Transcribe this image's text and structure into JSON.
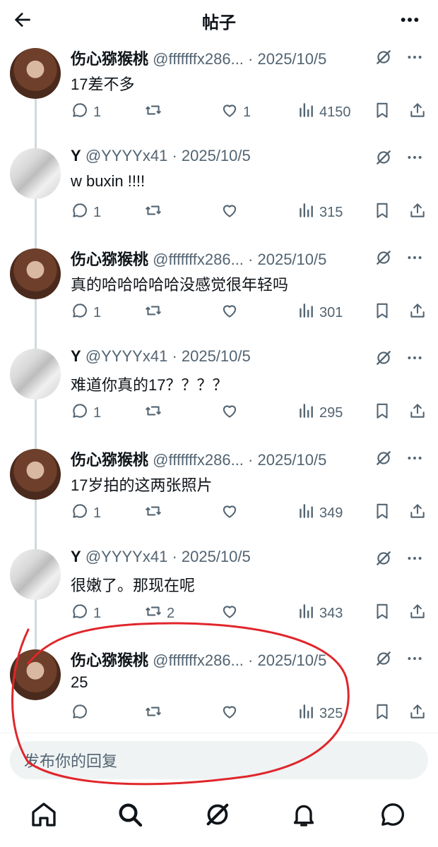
{
  "header": {
    "title": "帖子"
  },
  "tweets": [
    {
      "name": "伤心猕猴桃",
      "handle": "@fffffffx286...",
      "date": "· 2025/10/5",
      "text": "17差不多",
      "replies": "1",
      "retweets": "",
      "likes": "1",
      "views": "4150",
      "avatar": "female"
    },
    {
      "name": "Y",
      "handle": "@YYYYx41",
      "date": "· 2025/10/5",
      "text": "w buxin !!!!",
      "replies": "1",
      "retweets": "",
      "likes": "",
      "views": "315",
      "avatar": "y"
    },
    {
      "name": "伤心猕猴桃",
      "handle": "@fffffffx286...",
      "date": "· 2025/10/5",
      "text": "真的哈哈哈哈哈没感觉很年轻吗",
      "replies": "1",
      "retweets": "",
      "likes": "",
      "views": "301",
      "avatar": "female"
    },
    {
      "name": "Y",
      "handle": "@YYYYx41",
      "date": "· 2025/10/5",
      "text": "难道你真的17？？？？",
      "replies": "1",
      "retweets": "",
      "likes": "",
      "views": "295",
      "avatar": "y"
    },
    {
      "name": "伤心猕猴桃",
      "handle": "@fffffffx286...",
      "date": "· 2025/10/5",
      "text": "17岁拍的这两张照片",
      "replies": "1",
      "retweets": "",
      "likes": "",
      "views": "349",
      "avatar": "female"
    },
    {
      "name": "Y",
      "handle": "@YYYYx41",
      "date": "· 2025/10/5",
      "text": "很嫩了。那现在呢",
      "replies": "1",
      "retweets": "2",
      "likes": "",
      "views": "343",
      "avatar": "y"
    },
    {
      "name": "伤心猕猴桃",
      "handle": "@fffffffx286...",
      "date": "· 2025/10/5",
      "text": "25",
      "replies": "",
      "retweets": "",
      "likes": "",
      "views": "325",
      "avatar": "female"
    }
  ],
  "reply": {
    "placeholder": "发布你的回复"
  },
  "nav": [
    "home-icon",
    "search-icon",
    "grok-icon",
    "notifications-icon",
    "messages-icon"
  ],
  "colors": {
    "text": "#0f1419",
    "muted": "#536471",
    "annotation": "#e0262b"
  }
}
